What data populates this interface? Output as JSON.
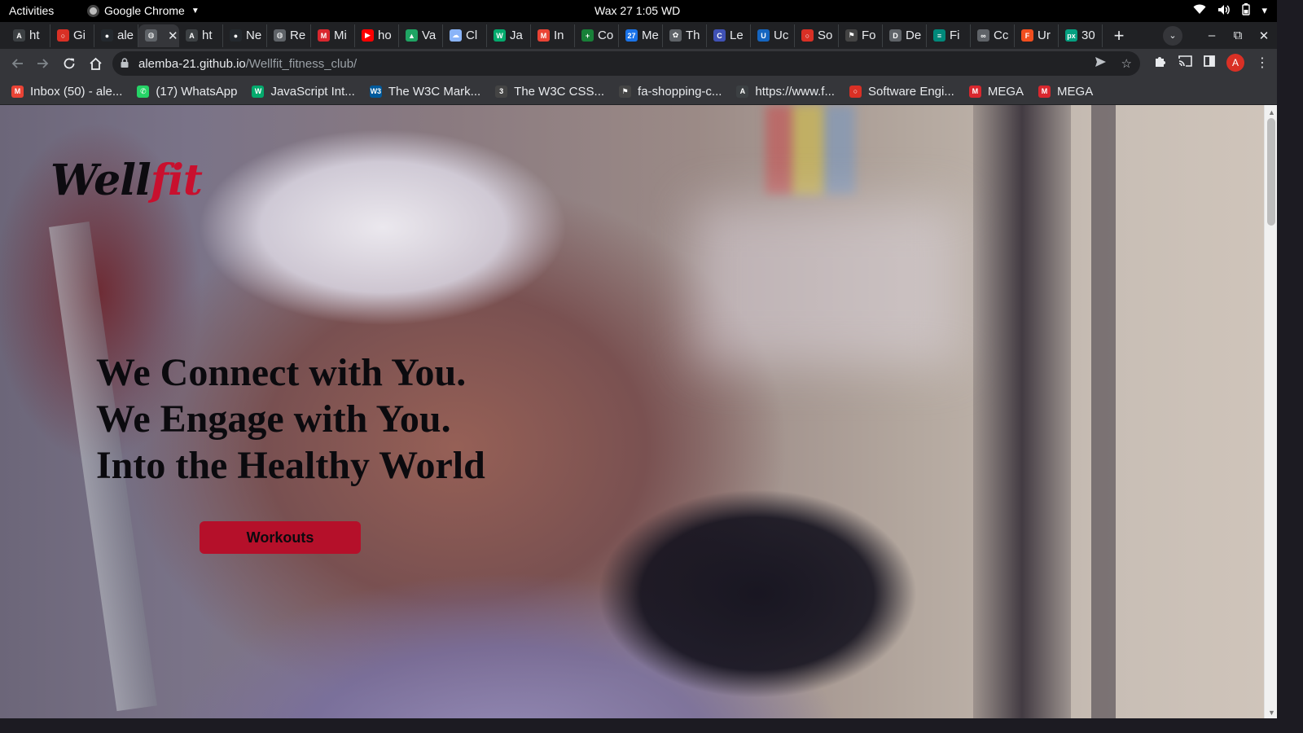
{
  "os_bar": {
    "activities": "Activities",
    "app_name": "Google Chrome",
    "clock": "Wax 27  1:05 WD"
  },
  "tabs": [
    {
      "label": "ht",
      "icon": "at-icon",
      "color": "#3c4043"
    },
    {
      "label": "Gi",
      "icon": "dotted-ring-icon",
      "color": "#d93025"
    },
    {
      "label": "ale",
      "icon": "github-icon",
      "color": "#24292e"
    },
    {
      "label": "",
      "icon": "globe-icon",
      "color": "#5f6368",
      "active": true
    },
    {
      "label": "ht",
      "icon": "at-icon",
      "color": "#3c4043"
    },
    {
      "label": "Ne",
      "icon": "github-icon",
      "color": "#24292e"
    },
    {
      "label": "Re",
      "icon": "globe-icon",
      "color": "#5f6368"
    },
    {
      "label": "Mi",
      "icon": "mega-icon",
      "color": "#d9272e"
    },
    {
      "label": "ho",
      "icon": "youtube-icon",
      "color": "#ff0000"
    },
    {
      "label": "Va",
      "icon": "drive-icon",
      "color": "#1fa463"
    },
    {
      "label": "Cl",
      "icon": "cloud-icon",
      "color": "#8ab4f8"
    },
    {
      "label": "Ja",
      "icon": "w-icon",
      "color": "#04aa6d"
    },
    {
      "label": "In",
      "icon": "gmail-icon",
      "color": "#ea4335"
    },
    {
      "label": "Co",
      "icon": "plus-icon",
      "color": "#188038"
    },
    {
      "label": "Me",
      "icon": "calendar-icon",
      "color": "#1a73e8"
    },
    {
      "label": "Th",
      "icon": "octocat-icon",
      "color": "#5f6368"
    },
    {
      "label": "Le",
      "icon": "c-icon",
      "color": "#3f51b5"
    },
    {
      "label": "Uc",
      "icon": "u-icon",
      "color": "#1565c0"
    },
    {
      "label": "So",
      "icon": "dotted-ring-icon",
      "color": "#d93025"
    },
    {
      "label": "Fo",
      "icon": "flag-icon",
      "color": "#444"
    },
    {
      "label": "De",
      "icon": "d-icon",
      "color": "#5f6368"
    },
    {
      "label": "Fi",
      "icon": "chart-icon",
      "color": "#00897b"
    },
    {
      "label": "Cc",
      "icon": "chain-icon",
      "color": "#5f6368"
    },
    {
      "label": "Ur",
      "icon": "figma-icon",
      "color": "#f24e1e"
    },
    {
      "label": "30",
      "icon": "px-icon",
      "color": "#05a081"
    }
  ],
  "omnibox": {
    "host": "alemba-21.github.io",
    "path": "/Wellfit_fitness_club/"
  },
  "profile_initial": "A",
  "bookmarks": [
    {
      "label": "Inbox (50) - ale...",
      "icon": "gmail-icon",
      "color": "#ea4335"
    },
    {
      "label": "(17) WhatsApp",
      "icon": "whatsapp-icon",
      "color": "#25d366"
    },
    {
      "label": "JavaScript Int...",
      "icon": "w-icon",
      "color": "#04aa6d"
    },
    {
      "label": "The W3C Mark...",
      "icon": "w3c-icon",
      "color": "#005a9c"
    },
    {
      "label": "The W3C CSS...",
      "icon": "css-icon",
      "color": "#444"
    },
    {
      "label": "fa-shopping-c...",
      "icon": "flag-icon",
      "color": "#444"
    },
    {
      "label": "https://www.f...",
      "icon": "at-icon",
      "color": "#3c4043"
    },
    {
      "label": "Software Engi...",
      "icon": "dotted-ring-icon",
      "color": "#d93025"
    },
    {
      "label": "MEGA",
      "icon": "mega-icon",
      "color": "#d9272e"
    },
    {
      "label": "MEGA",
      "icon": "mega-icon",
      "color": "#d9272e"
    }
  ],
  "page": {
    "logo_part1": "Well",
    "logo_part2": "fit",
    "hero_line1": "We Connect with You.",
    "hero_line2": "We Engage with You.",
    "hero_line3": "Into the Healthy World",
    "cta_label": "Workouts",
    "brand_color": "#c8102e"
  }
}
